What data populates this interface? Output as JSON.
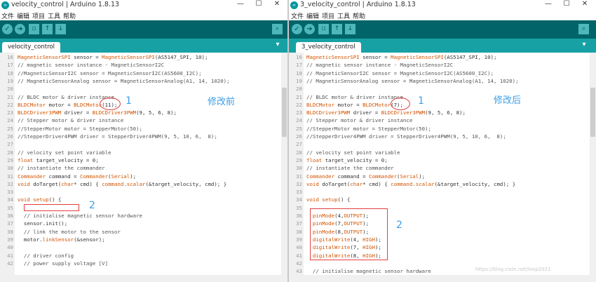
{
  "left": {
    "title": "velocity_control | Arduino 1.8.13",
    "menu": [
      "文件",
      "编辑",
      "项目",
      "工具",
      "帮助"
    ],
    "tab": "velocity_control",
    "annotation_1": "1",
    "annotation_2": "2",
    "annotation_label": "修改前",
    "lines": [
      {
        "n": "16",
        "parts": [
          [
            "typ",
            "MagneticSensorSPI"
          ],
          [
            "",
            " sensor = "
          ],
          [
            "typ",
            "MagneticSensorSPI"
          ],
          [
            "",
            "(AS5147_SPI, 10);"
          ]
        ]
      },
      {
        "n": "17",
        "parts": [
          [
            "cm",
            "// magnetic sensor instance - MagneticSensorI2C"
          ]
        ]
      },
      {
        "n": "18",
        "parts": [
          [
            "cm",
            "//MagneticSensorI2C sensor = MagneticSensorI2C(AS5600_I2C);"
          ]
        ]
      },
      {
        "n": "19",
        "parts": [
          [
            "cm",
            "// MagneticSensorAnalog sensor = MagneticSensorAnalog(A1, 14, 1020);"
          ]
        ]
      },
      {
        "n": "20",
        "parts": []
      },
      {
        "n": "21",
        "parts": [
          [
            "cm",
            "// BLDC motor & driver instance"
          ]
        ]
      },
      {
        "n": "22",
        "parts": [
          [
            "typ",
            "BLDCMotor"
          ],
          [
            "",
            " motor = "
          ],
          [
            "typ",
            "BLDCMotor"
          ],
          [
            "",
            "(11);"
          ]
        ]
      },
      {
        "n": "23",
        "parts": [
          [
            "typ",
            "BLDCDriver3PWM"
          ],
          [
            "",
            " driver = "
          ],
          [
            "typ",
            "BLDCDriver3PWM"
          ],
          [
            "",
            "(9, 5, 6, 8);"
          ]
        ]
      },
      {
        "n": "24",
        "parts": [
          [
            "cm",
            "// Stepper motor & driver instance"
          ]
        ]
      },
      {
        "n": "25",
        "parts": [
          [
            "cm",
            "//StepperMotor motor = StepperMotor(50);"
          ]
        ]
      },
      {
        "n": "26",
        "parts": [
          [
            "cm",
            "//StepperDriver4PWM driver = StepperDriver4PWM(9, 5, 10, 6,  8);"
          ]
        ]
      },
      {
        "n": "27",
        "parts": []
      },
      {
        "n": "28",
        "parts": [
          [
            "cm",
            "// velocity set point variable"
          ]
        ]
      },
      {
        "n": "29",
        "parts": [
          [
            "kw",
            "float"
          ],
          [
            "",
            " target_velocity = 0;"
          ]
        ]
      },
      {
        "n": "30",
        "parts": [
          [
            "cm",
            "// instantiate the commander"
          ]
        ]
      },
      {
        "n": "31",
        "parts": [
          [
            "typ",
            "Commander"
          ],
          [
            "",
            " command = "
          ],
          [
            "typ",
            "Commander"
          ],
          [
            "",
            "("
          ],
          [
            "typ",
            "Serial"
          ],
          [
            "",
            ");"
          ]
        ]
      },
      {
        "n": "32",
        "parts": [
          [
            "kw",
            "void"
          ],
          [
            "",
            " doTarget("
          ],
          [
            "kw",
            "char"
          ],
          [
            "",
            "* cmd) { "
          ],
          [
            "fn",
            "command.scalar"
          ],
          [
            "",
            "(&target_velocity, cmd); }"
          ]
        ]
      },
      {
        "n": "33",
        "parts": []
      },
      {
        "n": "34",
        "parts": [
          [
            "kw",
            "void"
          ],
          [
            "",
            " "
          ],
          [
            "kw",
            "setup"
          ],
          [
            "",
            "() {"
          ]
        ]
      },
      {
        "n": "35",
        "parts": []
      },
      {
        "n": "36",
        "parts": [
          [
            "cm",
            "  // initialise magnetic sensor hardware"
          ]
        ]
      },
      {
        "n": "37",
        "parts": [
          [
            "",
            "  sensor.init();"
          ]
        ]
      },
      {
        "n": "38",
        "parts": [
          [
            "cm",
            "  // link the motor to the sensor"
          ]
        ]
      },
      {
        "n": "39",
        "parts": [
          [
            "",
            "  motor."
          ],
          [
            "fn",
            "linkSensor"
          ],
          [
            "",
            "(&sensor);"
          ]
        ]
      },
      {
        "n": "40",
        "parts": []
      },
      {
        "n": "41",
        "parts": [
          [
            "cm",
            "  // driver config"
          ]
        ]
      },
      {
        "n": "42",
        "parts": [
          [
            "cm",
            "  // power supply voltage [V]"
          ]
        ]
      }
    ]
  },
  "right": {
    "title": "3_velocity_control | Arduino 1.8.13",
    "menu": [
      "文件",
      "编辑",
      "项目",
      "工具",
      "帮助"
    ],
    "tab": "3_velocity_control",
    "annotation_1": "1",
    "annotation_2": "2",
    "annotation_label": "修改后",
    "watermark": "https://blog.csdn.net/loop2021",
    "lines": [
      {
        "n": "16",
        "parts": [
          [
            "typ",
            "MagneticSensorSPI"
          ],
          [
            "",
            " sensor = "
          ],
          [
            "typ",
            "MagneticSensorSPI"
          ],
          [
            "",
            "(AS5147_SPI, 10);"
          ]
        ]
      },
      {
        "n": "17",
        "parts": [
          [
            "cm",
            "// magnetic sensor instance - MagneticSensorI2C"
          ]
        ]
      },
      {
        "n": "18",
        "parts": [
          [
            "cm",
            "// MagneticSensorI2C sensor = MagneticSensorI2C(AS5600_I2C);"
          ]
        ]
      },
      {
        "n": "19",
        "parts": [
          [
            "cm",
            "// MagneticSensorAnalog sensor = MagneticSensorAnalog(A1, 14, 1020);"
          ]
        ]
      },
      {
        "n": "20",
        "parts": []
      },
      {
        "n": "21",
        "parts": [
          [
            "cm",
            "// BLDC motor & driver instance"
          ]
        ]
      },
      {
        "n": "22",
        "parts": [
          [
            "typ",
            "BLDCMotor"
          ],
          [
            "",
            " motor = "
          ],
          [
            "typ",
            "BLDCMotor"
          ],
          [
            "",
            "(7);"
          ]
        ]
      },
      {
        "n": "23",
        "parts": [
          [
            "typ",
            "BLDCDriver3PWM"
          ],
          [
            "",
            " driver = "
          ],
          [
            "typ",
            "BLDCDriver3PWM"
          ],
          [
            "",
            "(9, 5, 6, 8);"
          ]
        ]
      },
      {
        "n": "24",
        "parts": [
          [
            "cm",
            "// Stepper motor & driver instance"
          ]
        ]
      },
      {
        "n": "25",
        "parts": [
          [
            "cm",
            "//StepperMotor motor = StepperMotor(50);"
          ]
        ]
      },
      {
        "n": "26",
        "parts": [
          [
            "cm",
            "//StepperDriver4PWM driver = StepperDriver4PWM(9, 5, 10, 6,  8);"
          ]
        ]
      },
      {
        "n": "27",
        "parts": []
      },
      {
        "n": "28",
        "parts": [
          [
            "cm",
            "// velocity set point variable"
          ]
        ]
      },
      {
        "n": "29",
        "parts": [
          [
            "kw",
            "float"
          ],
          [
            "",
            " target_velocity = 0;"
          ]
        ]
      },
      {
        "n": "30",
        "parts": [
          [
            "cm",
            "// instantiate the commander"
          ]
        ]
      },
      {
        "n": "31",
        "parts": [
          [
            "typ",
            "Commander"
          ],
          [
            "",
            " command = "
          ],
          [
            "typ",
            "Commander"
          ],
          [
            "",
            "("
          ],
          [
            "typ",
            "Serial"
          ],
          [
            "",
            ");"
          ]
        ]
      },
      {
        "n": "32",
        "parts": [
          [
            "kw",
            "void"
          ],
          [
            "",
            " doTarget("
          ],
          [
            "kw",
            "char"
          ],
          [
            "",
            "* cmd) { "
          ],
          [
            "fn",
            "command.scalar"
          ],
          [
            "",
            "(&target_velocity, cmd); }"
          ]
        ]
      },
      {
        "n": "33",
        "parts": []
      },
      {
        "n": "34",
        "parts": [
          [
            "kw",
            "void"
          ],
          [
            "",
            " "
          ],
          [
            "kw",
            "setup"
          ],
          [
            "",
            "() {"
          ]
        ]
      },
      {
        "n": "35",
        "parts": []
      },
      {
        "n": "36",
        "parts": [
          [
            "",
            "  "
          ],
          [
            "fn",
            "pinMode"
          ],
          [
            "",
            "(4,"
          ],
          [
            "typ",
            "OUTPUT"
          ],
          [
            "",
            ");"
          ]
        ]
      },
      {
        "n": "37",
        "parts": [
          [
            "",
            "  "
          ],
          [
            "fn",
            "pinMode"
          ],
          [
            "",
            "(7,"
          ],
          [
            "typ",
            "OUTPUT"
          ],
          [
            "",
            ");"
          ]
        ]
      },
      {
        "n": "38",
        "parts": [
          [
            "",
            "  "
          ],
          [
            "fn",
            "pinMode"
          ],
          [
            "",
            "(8,"
          ],
          [
            "typ",
            "OUTPUT"
          ],
          [
            "",
            ");"
          ]
        ]
      },
      {
        "n": "39",
        "parts": [
          [
            "",
            "  "
          ],
          [
            "fn",
            "digitalWrite"
          ],
          [
            "",
            "(4, "
          ],
          [
            "typ",
            "HIGH"
          ],
          [
            "",
            ");"
          ]
        ]
      },
      {
        "n": "40",
        "parts": [
          [
            "",
            "  "
          ],
          [
            "fn",
            "digitalWrite"
          ],
          [
            "",
            "(7, "
          ],
          [
            "typ",
            "HIGH"
          ],
          [
            "",
            ");"
          ]
        ]
      },
      {
        "n": "41",
        "parts": [
          [
            "",
            "  "
          ],
          [
            "fn",
            "digitalWrite"
          ],
          [
            "",
            "(8, "
          ],
          [
            "typ",
            "HIGH"
          ],
          [
            "",
            ");"
          ]
        ]
      },
      {
        "n": "42",
        "parts": []
      },
      {
        "n": "43",
        "parts": [
          [
            "cm",
            "  // initialise magnetic sensor hardware"
          ]
        ]
      }
    ]
  },
  "controls": {
    "minimize": "—",
    "maximize": "☐",
    "close": "✕"
  },
  "colors": {
    "toolbar": "#006468",
    "tabbar": "#17a1a5",
    "annotation": "#3a9ee6",
    "highlight": "#e04040"
  }
}
